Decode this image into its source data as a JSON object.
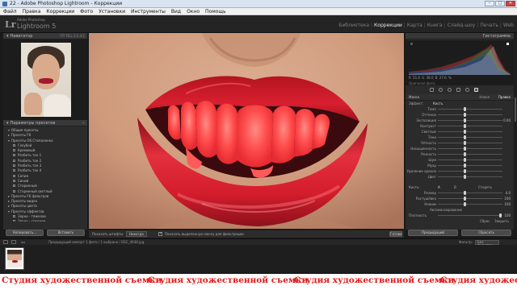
{
  "window": {
    "title": "22 - Adobe Photoshop Lightroom - Коррекции",
    "controls": [
      "–",
      "□",
      "✕"
    ]
  },
  "menu": [
    "Файл",
    "Правка",
    "Коррекции",
    "Фото",
    "Установки",
    "Инструменты",
    "Вид",
    "Окно",
    "Помощь"
  ],
  "app": {
    "logo": "Lr",
    "small": "Adobe Photoshop",
    "name": "Lightroom 5"
  },
  "modules": [
    {
      "label": "Библиотека",
      "active": false
    },
    {
      "label": "Коррекции",
      "active": true
    },
    {
      "label": "Карта",
      "active": false
    },
    {
      "label": "Книга",
      "active": false
    },
    {
      "label": "Слайд-шоу",
      "active": false
    },
    {
      "label": "Печать",
      "active": false
    },
    {
      "label": "Web",
      "active": false
    }
  ],
  "left_panel": {
    "navigator_title": "Навигатор",
    "navigator_options": "FIT  FILL  1:1  4:1",
    "presets_title": "Параметры пресетов",
    "presets": [
      {
        "label": "Общие пресеты",
        "level": "top",
        "open": true
      },
      {
        "label": "Пресеты F6",
        "level": "top",
        "open": false
      },
      {
        "label": "Пресеты Об.Степаненко",
        "level": "top",
        "open": true
      },
      {
        "label": "Голубой",
        "level": "sub"
      },
      {
        "label": "Кремовый",
        "level": "sub"
      },
      {
        "label": "Разбить тон 1",
        "level": "sub"
      },
      {
        "label": "Разбить тон 2",
        "level": "sub"
      },
      {
        "label": "Разбить тон 3",
        "level": "sub"
      },
      {
        "label": "Разбить тон 4",
        "level": "sub"
      },
      {
        "label": "Сепия",
        "level": "sub"
      },
      {
        "label": "Синий",
        "level": "sub"
      },
      {
        "label": "Старинный",
        "level": "sub"
      },
      {
        "label": "Старинный светлый",
        "level": "sub"
      },
      {
        "label": "Пресеты F6 фильтров",
        "level": "top",
        "open": false
      },
      {
        "label": "Пресеты видео",
        "level": "top",
        "open": false
      },
      {
        "label": "Пресеты цвета",
        "level": "top",
        "open": false
      },
      {
        "label": "Пресеты эффектов",
        "level": "top",
        "open": true
      },
      {
        "label": "Зерно - тяжелое",
        "level": "sub"
      },
      {
        "label": "Зерно - среднее",
        "level": "sub"
      }
    ],
    "copy_button": "Копировать...",
    "paste_button": "Вставить"
  },
  "toolbar": {
    "show_edited_pins": "Показать штифты",
    "pins_mode": "Никогда",
    "auto_mask_label": "Показать выделенную маску для фильтрации",
    "done_button": "Готово"
  },
  "right_panel": {
    "histogram_title": "Гистограмма",
    "histogram_info": "R  51.6   G  38.0   B  27.6  %",
    "original_photo": "Оригинал фото",
    "mask_label": "Маска",
    "mask_new": "Новая",
    "mask_edit": "Правка",
    "effect_label": "Эффект:",
    "effect_value": "Кисть",
    "sliders": [
      {
        "label": "Темп",
        "value": ""
      },
      {
        "label": "Оттенок",
        "value": ""
      },
      {
        "label": "Экспозиция",
        "value": "0.00"
      },
      {
        "label": "Контраст",
        "value": ""
      },
      {
        "label": "Светлые",
        "value": ""
      },
      {
        "label": "Тени",
        "value": ""
      },
      {
        "label": "Чёткость",
        "value": ""
      },
      {
        "label": "Насыщенность",
        "value": ""
      },
      {
        "label": "Резкость",
        "value": ""
      },
      {
        "label": "Шум",
        "value": ""
      },
      {
        "label": "Муар",
        "value": ""
      },
      {
        "label": "Удаление ореола",
        "value": ""
      },
      {
        "label": "Цвет",
        "value": ""
      }
    ],
    "brush_label": "Кисть:",
    "brush_a": "A",
    "brush_b": "B",
    "brush_erase": "Стереть",
    "brush_sliders": [
      {
        "label": "Размер",
        "value": "4.0"
      },
      {
        "label": "Растушёвка",
        "value": "100"
      },
      {
        "label": "Нажим",
        "value": "100"
      }
    ],
    "auto_mask": "Автомаскирование",
    "density_label": "Плотность",
    "density_value": "100",
    "reset_button": "Сброс",
    "close_button": "Закрыть",
    "previous_button": "Предыдущий",
    "default_button": "Сбросить"
  },
  "filmbar": {
    "path": "Предыдущий импорт  1 фото / 1 выбрано / DSC_4938.jpg",
    "filter_label": "Фильтр:",
    "filter_value": "Без фильтра"
  },
  "watermark": {
    "text": "Студия художественной съемки"
  },
  "colors": {
    "lip_red": "#d91f2f",
    "teeth_highlight": "#ff4b4b",
    "skin": "#d4a084",
    "panel_bg": "#2b2b2b",
    "watermark_red": "#e21a1a"
  }
}
